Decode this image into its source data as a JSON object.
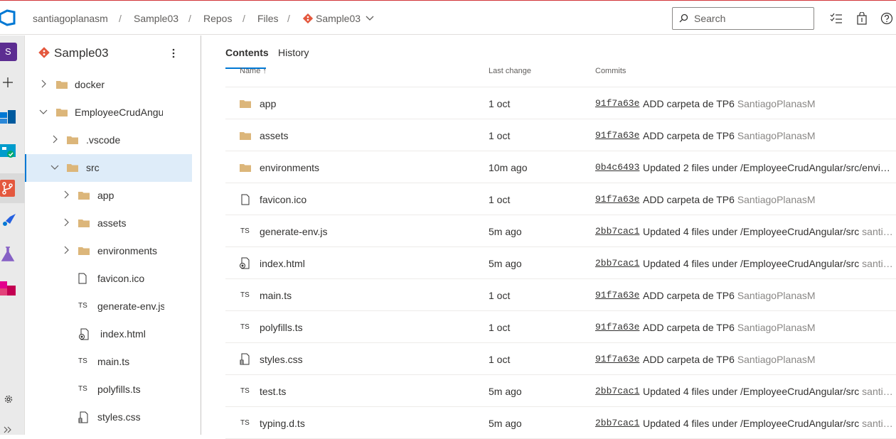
{
  "breadcrumb": {
    "items": [
      "santiagoplanasm",
      "Sample03",
      "Repos",
      "Files",
      "Sample03"
    ],
    "separator": "/"
  },
  "search": {
    "placeholder": "Search"
  },
  "left_rail": {
    "avatar_letter": "S",
    "icons": [
      "add-icon",
      "overview-icon",
      "boards-icon",
      "repos-icon",
      "pipelines-icon",
      "test-plans-icon",
      "artifacts-icon",
      "settings-icon",
      "expand-icon"
    ]
  },
  "tree": {
    "repo_title": "Sample03",
    "items": [
      {
        "label": "docker",
        "type": "folder",
        "expanded": false,
        "level": 0
      },
      {
        "label": "EmployeeCrudAngular",
        "type": "folder",
        "expanded": true,
        "level": 0
      },
      {
        "label": ".vscode",
        "type": "folder",
        "expanded": false,
        "level": 1
      },
      {
        "label": "src",
        "type": "folder",
        "expanded": true,
        "level": 1,
        "selected": true
      },
      {
        "label": "app",
        "type": "folder",
        "expanded": false,
        "level": 2
      },
      {
        "label": "assets",
        "type": "folder",
        "expanded": false,
        "level": 2
      },
      {
        "label": "environments",
        "type": "folder",
        "expanded": false,
        "level": 2
      },
      {
        "label": "favicon.ico",
        "type": "file",
        "level": 2
      },
      {
        "label": "generate-env.js",
        "type": "ts",
        "level": 2
      },
      {
        "label": "index.html",
        "type": "html",
        "level": 2
      },
      {
        "label": "main.ts",
        "type": "ts",
        "level": 2
      },
      {
        "label": "polyfills.ts",
        "type": "ts",
        "level": 2
      },
      {
        "label": "styles.css",
        "type": "css",
        "level": 2
      }
    ]
  },
  "tabs": [
    {
      "label": "Contents",
      "active": true
    },
    {
      "label": "History",
      "active": false
    }
  ],
  "columns": {
    "name": "Name ↑",
    "last_change": "Last change",
    "commits": "Commits"
  },
  "files": [
    {
      "name": "app",
      "type": "folder",
      "last_change": "1 oct",
      "hash": "91f7a63e",
      "message": "ADD carpeta de TP6",
      "author": "SantiagoPlanasM"
    },
    {
      "name": "assets",
      "type": "folder",
      "last_change": "1 oct",
      "hash": "91f7a63e",
      "message": "ADD carpeta de TP6",
      "author": "SantiagoPlanasM"
    },
    {
      "name": "environments",
      "type": "folder",
      "last_change": "10m ago",
      "hash": "0b4c6493",
      "message": "Updated 2 files under /EmployeeCrudAngular/src/envi…",
      "author": ""
    },
    {
      "name": "favicon.ico",
      "type": "file",
      "last_change": "1 oct",
      "hash": "91f7a63e",
      "message": "ADD carpeta de TP6",
      "author": "SantiagoPlanasM"
    },
    {
      "name": "generate-env.js",
      "type": "ts",
      "last_change": "5m ago",
      "hash": "2bb7cac1",
      "message": "Updated 4 files under /EmployeeCrudAngular/src",
      "author": "santi…"
    },
    {
      "name": "index.html",
      "type": "html",
      "last_change": "5m ago",
      "hash": "2bb7cac1",
      "message": "Updated 4 files under /EmployeeCrudAngular/src",
      "author": "santi…"
    },
    {
      "name": "main.ts",
      "type": "ts",
      "last_change": "1 oct",
      "hash": "91f7a63e",
      "message": "ADD carpeta de TP6",
      "author": "SantiagoPlanasM"
    },
    {
      "name": "polyfills.ts",
      "type": "ts",
      "last_change": "1 oct",
      "hash": "91f7a63e",
      "message": "ADD carpeta de TP6",
      "author": "SantiagoPlanasM"
    },
    {
      "name": "styles.css",
      "type": "css",
      "last_change": "1 oct",
      "hash": "91f7a63e",
      "message": "ADD carpeta de TP6",
      "author": "SantiagoPlanasM"
    },
    {
      "name": "test.ts",
      "type": "ts",
      "last_change": "5m ago",
      "hash": "2bb7cac1",
      "message": "Updated 4 files under /EmployeeCrudAngular/src",
      "author": "santi…"
    },
    {
      "name": "typing.d.ts",
      "type": "ts",
      "last_change": "5m ago",
      "hash": "2bb7cac1",
      "message": "Updated 4 files under /EmployeeCrudAngular/src",
      "author": "santi…"
    }
  ],
  "colors": {
    "accent": "#0078d4",
    "folder": "#dcb67a",
    "selected_row": "#deecf9",
    "git_repo": "#e4583e",
    "top_line": "#d13438"
  }
}
